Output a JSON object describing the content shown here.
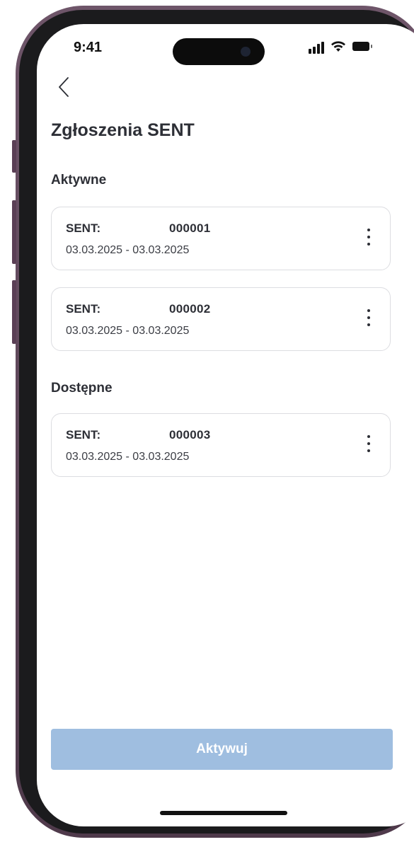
{
  "status_bar": {
    "time": "9:41",
    "icons": [
      "signal-icon",
      "wifi-icon",
      "battery-icon"
    ]
  },
  "header": {
    "back_icon": "chevron-left-icon",
    "title": "Zgłoszenia SENT"
  },
  "sections": {
    "active": {
      "title": "Aktywne",
      "items": [
        {
          "label": "SENT:",
          "number": "000001",
          "dates": "03.03.2025 - 03.03.2025"
        },
        {
          "label": "SENT:",
          "number": "000002",
          "dates": "03.03.2025 - 03.03.2025"
        }
      ]
    },
    "available": {
      "title": "Dostępne",
      "items": [
        {
          "label": "SENT:",
          "number": "000003",
          "dates": "03.03.2025 - 03.03.2025"
        }
      ]
    }
  },
  "footer": {
    "activate_label": "Aktywuj"
  },
  "colors": {
    "frame": "#5a4056",
    "button_disabled": "#9fbee0",
    "text": "#2d2f36",
    "card_border": "#dcdde1"
  }
}
